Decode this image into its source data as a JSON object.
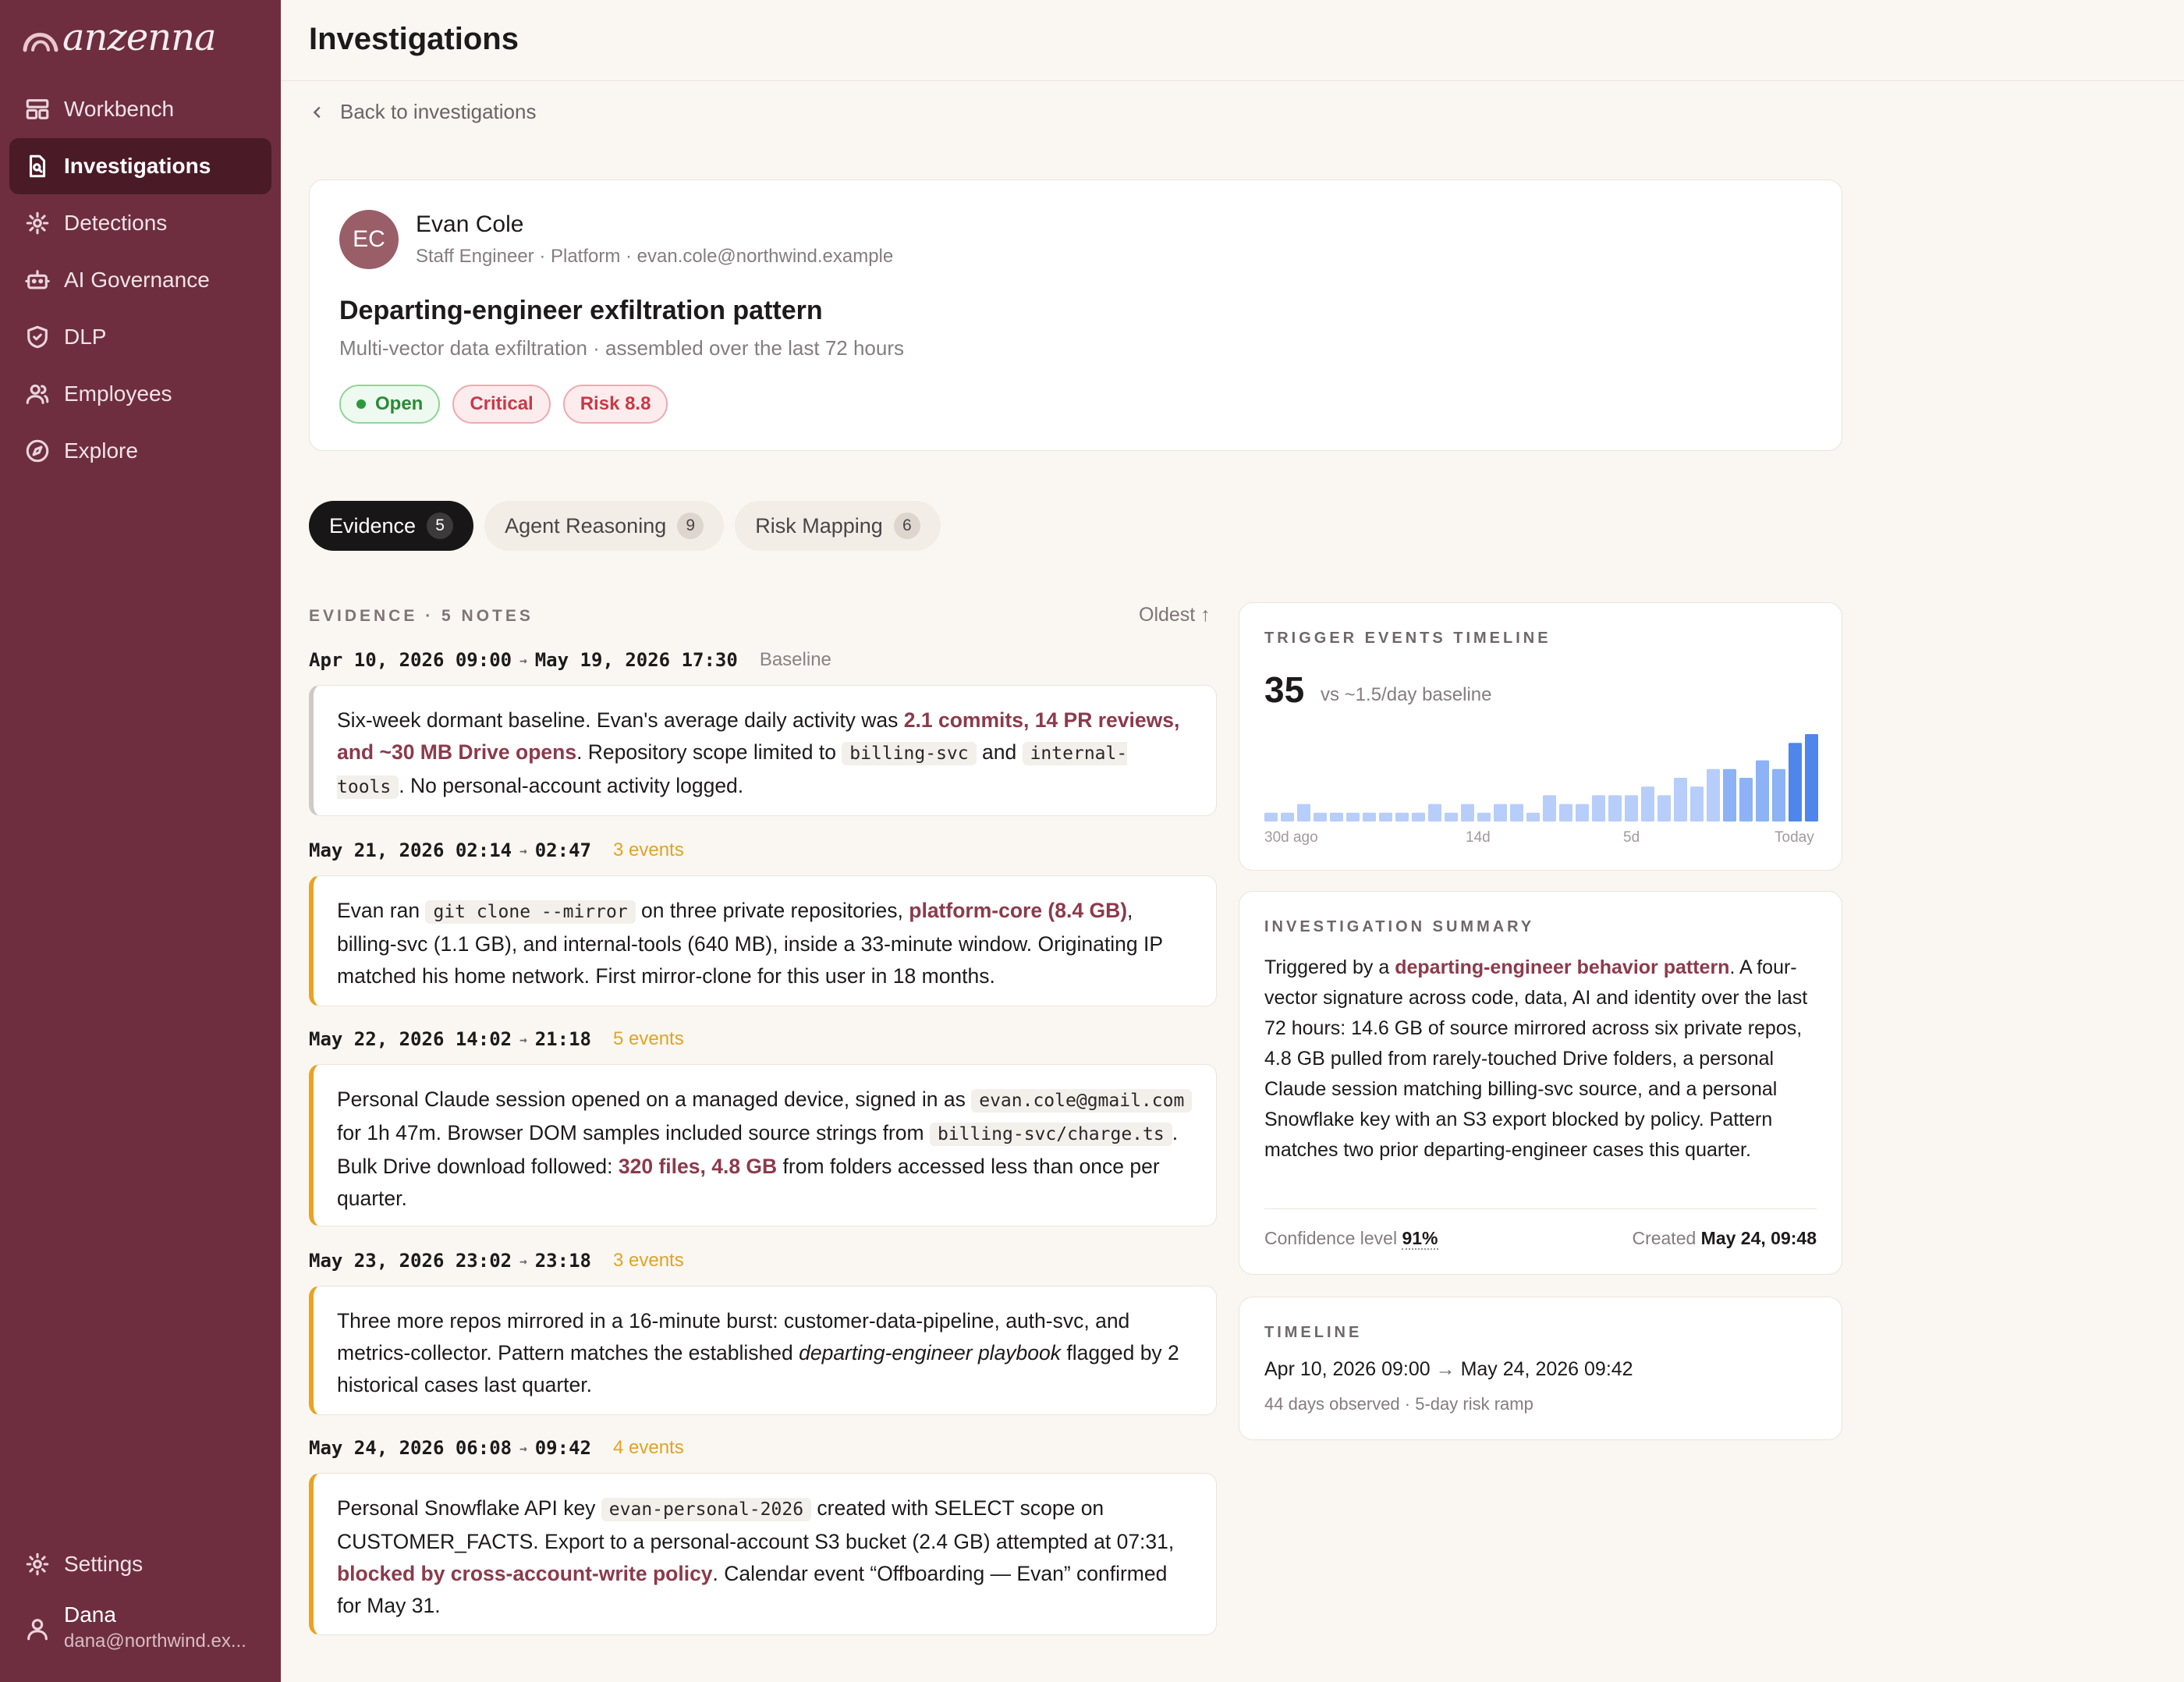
{
  "app": {
    "logo_text": "anzenna"
  },
  "sidebar": {
    "items": [
      {
        "label": "Workbench",
        "icon": "layout-icon"
      },
      {
        "label": "Investigations",
        "icon": "document-search-icon",
        "active": true
      },
      {
        "label": "Detections",
        "icon": "sparkle-icon"
      },
      {
        "label": "AI Governance",
        "icon": "robot-icon"
      },
      {
        "label": "DLP",
        "icon": "shield-icon"
      },
      {
        "label": "Employees",
        "icon": "users-icon"
      },
      {
        "label": "Explore",
        "icon": "compass-icon"
      }
    ],
    "settings_label": "Settings",
    "user": {
      "name": "Dana",
      "email": "dana@northwind.ex..."
    }
  },
  "header": {
    "title": "Investigations",
    "back_label": "Back to investigations"
  },
  "investigation": {
    "avatar_initials": "EC",
    "person_name": "Evan Cole",
    "person_meta": "Staff Engineer · Platform · evan.cole@northwind.example",
    "title": "Departing-engineer exfiltration pattern",
    "subtitle": "Multi-vector data exfiltration · assembled over the last 72 hours",
    "badges": {
      "status": "Open",
      "severity": "Critical",
      "risk": "Risk 8.8"
    }
  },
  "tabs": [
    {
      "label": "Evidence",
      "count": "5"
    },
    {
      "label": "Agent Reasoning",
      "count": "9"
    },
    {
      "label": "Risk Mapping",
      "count": "6"
    }
  ],
  "evidence": {
    "section_label": "EVIDENCE · 5 NOTES",
    "sort_label": "Oldest ↑",
    "items": [
      {
        "start": "Apr 10, 2026 09:00",
        "end": "May 19, 2026 17:30",
        "tag": "Baseline",
        "t1": "Six-week dormant baseline. Evan's average daily activity was ",
        "h1": "2.1 commits, 14 PR reviews, and ~30 MB Drive opens",
        "t2": ". Repository scope limited to ",
        "c1": "billing-svc",
        "t3": " and ",
        "c2": "internal-tools",
        "t4": ". No personal-account activity logged."
      },
      {
        "start": "May 21, 2026 02:14",
        "end": "02:47",
        "tag": "3 events",
        "t1": "Evan ran ",
        "c1": "git clone --mirror",
        "t2": " on three private repositories, ",
        "h1": "platform-core (8.4 GB)",
        "t3": ", billing-svc (1.1 GB), and internal-tools (640 MB), inside a 33-minute window. Originating IP matched his home network. First mirror-clone for this user in 18 months."
      },
      {
        "start": "May 22, 2026 14:02",
        "end": "21:18",
        "tag": "5 events",
        "t1": "Personal Claude session opened on a managed device, signed in as ",
        "c1": "evan.cole@gmail.com",
        "t2": " for 1h 47m. Browser DOM samples included source strings from ",
        "c2": "billing-svc/charge.ts",
        "t3": ". Bulk Drive download followed: ",
        "h1": "320 files, 4.8 GB",
        "t4": " from folders accessed less than once per quarter."
      },
      {
        "start": "May 23, 2026 23:02",
        "end": "23:18",
        "tag": "3 events",
        "t1": "Three more repos mirrored in a 16-minute burst: customer-data-pipeline, auth-svc, and metrics-collector. Pattern matches the established ",
        "i1": "departing-engineer playbook",
        "t2": " flagged by 2 historical cases last quarter."
      },
      {
        "start": "May 24, 2026 06:08",
        "end": "09:42",
        "tag": "4 events",
        "t1": "Personal Snowflake API key ",
        "c1": "evan-personal-2026",
        "t2": " created with SELECT scope on CUSTOMER_FACTS. Export to a personal-account S3 bucket (2.4 GB) attempted at 07:31, ",
        "h1": "blocked by cross-account-write policy",
        "t3": ". Calendar event “Offboarding — Evan” confirmed for May 31."
      }
    ]
  },
  "trigger_timeline": {
    "title": "TRIGGER EVENTS TIMELINE",
    "count": "35",
    "baseline": "vs ~1.5/day baseline",
    "axis_labels": [
      "30d ago",
      "14d",
      "5d",
      "Today"
    ],
    "bar_color": "#b7cdfa",
    "highlight_color": "#4f86ec"
  },
  "chart_data": {
    "type": "bar",
    "values": [
      1,
      1,
      2,
      1,
      1,
      1,
      1,
      1,
      1,
      1,
      2,
      1,
      2,
      1,
      2,
      2,
      1,
      3,
      2,
      2,
      3,
      3,
      3,
      4,
      3,
      5,
      4,
      6,
      6,
      5,
      7,
      6,
      9,
      10
    ],
    "highlighted_last": 6
  },
  "summary": {
    "title": "INVESTIGATION SUMMARY",
    "t1": "Triggered by a ",
    "h1": "departing-engineer behavior pattern",
    "t2": ". A four-vector signature across code, data, AI and identity over the last 72 hours: 14.6 GB of source mirrored across six private repos, 4.8 GB pulled from rarely-touched Drive folders, a personal Claude session matching billing-svc source, and a personal Snowflake key with an S3 export blocked by policy. Pattern matches two prior departing-engineer cases this quarter.",
    "confidence_label": "Confidence level",
    "confidence_value": "91%",
    "created_label": "Created",
    "created_value": "May 24, 09:48"
  },
  "timeline": {
    "title": "TIMELINE",
    "start": "Apr 10, 2026 09:00",
    "end": "May 24, 2026 09:42",
    "sub": "44 days observed · 5-day risk ramp"
  }
}
